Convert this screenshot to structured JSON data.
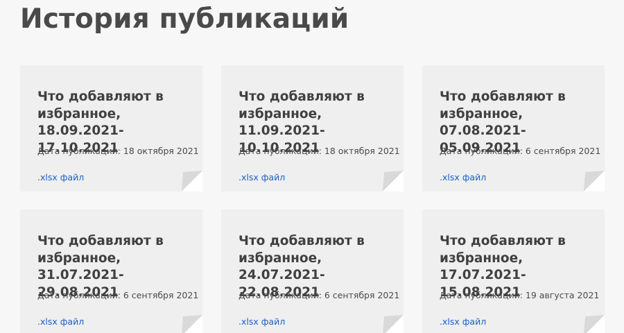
{
  "page": {
    "title": "История публикаций"
  },
  "cards": [
    {
      "title_line1": "Что добавляют в",
      "title_line2": "избранное,",
      "title_line3": "18.09.2021- 17.10.2021",
      "date": "Дата публикации: 18 октября 2021",
      "link": ".xlsx файл"
    },
    {
      "title_line1": "Что добавляют в",
      "title_line2": "избранное,",
      "title_line3": "11.09.2021- 10.10.2021",
      "date": "Дата публикации: 18 октября 2021",
      "link": ".xlsx файл"
    },
    {
      "title_line1": "Что добавляют в",
      "title_line2": "избранное,",
      "title_line3": "07.08.2021- 05.09.2021",
      "date": "Дата публикации: 6 сентября 2021",
      "link": ".xlsx файл"
    },
    {
      "title_line1": "Что добавляют в",
      "title_line2": "избранное,",
      "title_line3": "31.07.2021- 29.08.2021",
      "date": "Дата публикации: 6 сентября 2021",
      "link": ".xlsx файл"
    },
    {
      "title_line1": "Что добавляют в",
      "title_line2": "избранное,",
      "title_line3": "24.07.2021- 22.08.2021",
      "date": "Дата публикации: 6 сентября 2021",
      "link": ".xlsx файл"
    },
    {
      "title_line1": "Что добавляют в",
      "title_line2": "избранное,",
      "title_line3": "17.07.2021- 15.08.2021",
      "date": "Дата публикации: 19 августа 2021",
      "link": ".xlsx файл"
    }
  ],
  "colors": {
    "background": "#f7f7f7",
    "card": "#efefef",
    "title": "#4a4a4a",
    "link": "#1a5fc4",
    "fold_light": "#ffffff",
    "fold_dark": "#dcdcdc"
  },
  "icons": {
    "card_corner": "page-fold-corner"
  }
}
